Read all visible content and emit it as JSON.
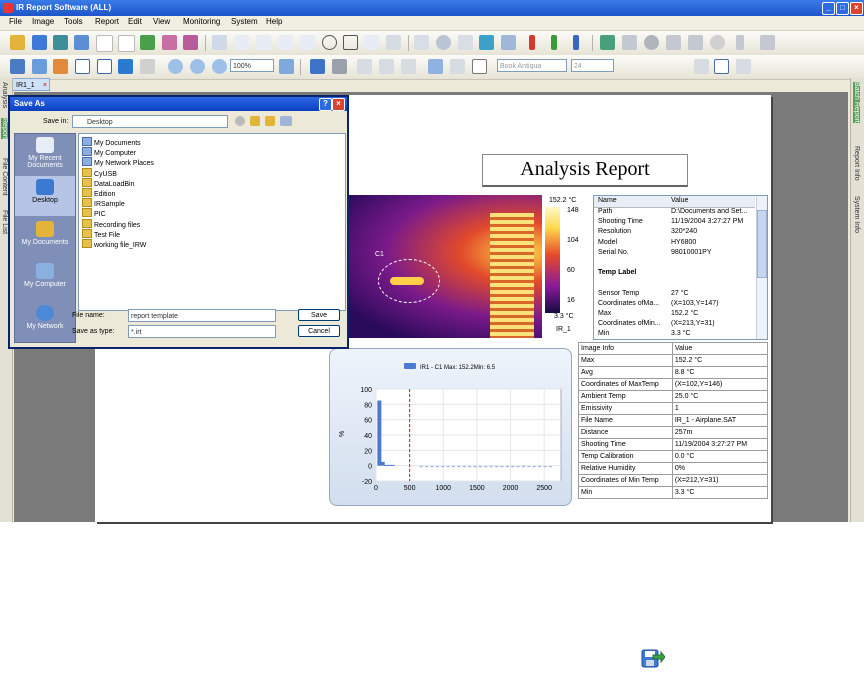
{
  "app": {
    "title": "IR Report Software (ALL)",
    "menu": [
      "File",
      "Image",
      "Tools",
      "Report",
      "Edit",
      "View",
      "Monitoring",
      "System",
      "Help"
    ]
  },
  "toolbar2": {
    "zoom": "100%",
    "font": "Book Antiqua",
    "font_size": "24",
    "bold": "B",
    "italic": "I",
    "underline": "U"
  },
  "tab": {
    "label": "IR1_1"
  },
  "left_tabs": [
    "Analysis",
    "Report",
    "File Content",
    "File List"
  ],
  "right_tabs": [
    "Batch Report",
    "Report Info",
    "System Info"
  ],
  "report": {
    "title": "Analysis Report",
    "thermo": {
      "max": "152.2 °C",
      "min": "3.3 °C",
      "ticks": [
        "148",
        "104",
        "60",
        "16"
      ],
      "name": "IR_1",
      "spot": "C1"
    },
    "info_header": [
      "Name",
      "Value"
    ],
    "info_rows": [
      [
        "Path",
        "D:\\Documents and Set..."
      ],
      [
        "Shooting Time",
        "11/19/2004 3:27:27 PM"
      ],
      [
        "Resolution",
        "320*240"
      ],
      [
        "Model",
        "HY6800"
      ],
      [
        "Serial No.",
        "98010001PY"
      ],
      [
        "",
        ""
      ],
      [
        "Temp Label",
        ""
      ],
      [
        "",
        ""
      ],
      [
        "Sensor Temp",
        "27 °C"
      ],
      [
        "Coordinates ofMa...",
        "(X=103,Y=147)"
      ],
      [
        "Max",
        "152.2 °C"
      ],
      [
        "Coordinates ofMin...",
        "(X=213,Y=31)"
      ],
      [
        "Min",
        "3.3 °C"
      ]
    ],
    "stats_rows": [
      [
        "Image Info",
        "Value"
      ],
      [
        "Max",
        "152.2 °C"
      ],
      [
        "Avg",
        "8.8 °C"
      ],
      [
        "Coordinates of MaxTemp",
        "(X=102,Y=146)"
      ],
      [
        "Ambient Temp",
        "25.0 °C"
      ],
      [
        "Emissivity",
        "1"
      ],
      [
        "File Name",
        "IR_1 - Airplane.SAT"
      ],
      [
        "Distance",
        "257m"
      ],
      [
        "Shooting Time",
        "11/19/2004 3:27:27 PM"
      ],
      [
        "Temp Calibration",
        "0.0 °C"
      ],
      [
        "Relative Humidity",
        "0%"
      ],
      [
        "Coordinates of Min Temp",
        "(X=212,Y=31)"
      ],
      [
        "Min",
        "3.3 °C"
      ]
    ]
  },
  "chart_data": {
    "type": "bar",
    "legend": "IR1 - C1 Max: 152.2Min: 6.5",
    "ylabel": "%",
    "xlim": [
      0,
      2750
    ],
    "ylim": [
      -20,
      100
    ],
    "xticks": [
      0,
      500,
      1000,
      1500,
      2000,
      2500
    ],
    "yticks": [
      100,
      80,
      60,
      40,
      20,
      0,
      -20
    ],
    "marker_x": 500,
    "x": [
      50,
      100,
      150,
      200,
      250
    ],
    "values": [
      85,
      5,
      1,
      1,
      1
    ]
  },
  "dialog": {
    "title": "Save As",
    "save_in_label": "Save in:",
    "save_in_value": "Desktop",
    "places": [
      "My Recent Documents",
      "Desktop",
      "My Documents",
      "My Computer",
      "My Network"
    ],
    "files": [
      "My Documents",
      "My Computer",
      "My Network Places",
      "CyUSB",
      "DataLoadBin",
      "Edition",
      "IRSample",
      "PIC",
      "Recording files",
      "Test File",
      "working file_IRW"
    ],
    "file_name_label": "File name:",
    "file_name_value": "report template",
    "save_type_label": "Save as type:",
    "save_type_value": "*.irt",
    "save_button": "Save",
    "cancel_button": "Cancel"
  }
}
